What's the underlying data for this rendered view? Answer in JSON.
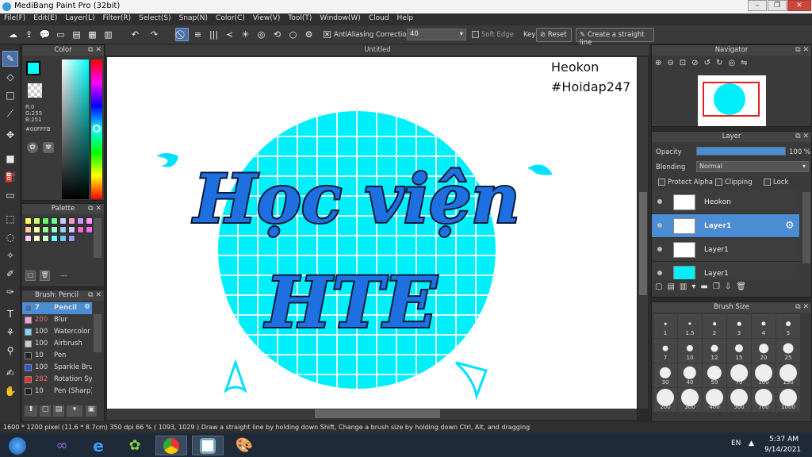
{
  "window": {
    "title": "MediBang Paint Pro (32bit)"
  },
  "menu": [
    "File(F)",
    "Edit(E)",
    "Layer(L)",
    "Filter(R)",
    "Select(S)",
    "Snap(N)",
    "Color(C)",
    "View(V)",
    "Tool(T)",
    "Window(W)",
    "Cloud",
    "Help"
  ],
  "toolbar": {
    "antialiasing_label": "AntiAliasing",
    "correction_label": "Correction",
    "correction_value": "40",
    "softedge_label": "Soft Edge",
    "key_label": "Key",
    "reset_label": "Reset",
    "straight_line_label": "Create a straight line"
  },
  "color_panel": {
    "title": "Color",
    "foreground": "#00FFFB",
    "r": "R:0",
    "g": "G:255",
    "b": "B:251",
    "hex": "#00FFFB"
  },
  "palette_panel": {
    "title": "Palette",
    "footer_text": "---",
    "colors": [
      "#ffff66",
      "#ccff66",
      "#66ff66",
      "#66ff99",
      "#ccccff",
      "#ff99cc",
      "#cc99ff",
      "#ff99ff",
      "#ffcc99",
      "#ffff99",
      "#99ff99",
      "#99ffcc",
      "#99ccff",
      "#ccccff",
      "#ff66cc",
      "#ff66ff",
      "#ffccff",
      "#ffffcc",
      "#ccffcc",
      "#66ffff",
      "#66ccff",
      "#9999ff"
    ]
  },
  "brush_panel": {
    "title": "Brush: Pencil",
    "items": [
      {
        "size": "7",
        "name": "Pencil",
        "color": "#3b6fd1",
        "selected": true
      },
      {
        "size": "200",
        "name": "Blur",
        "color": "#f2a2d8"
      },
      {
        "size": "100",
        "name": "Watercolor",
        "color": "#7fd4ff"
      },
      {
        "size": "100",
        "name": "Airbrush",
        "color": "#cccccc"
      },
      {
        "size": "10",
        "name": "Pen",
        "color": "#222222"
      },
      {
        "size": "100",
        "name": "Sparkle Brush",
        "color": "#3050e0"
      },
      {
        "size": "282",
        "name": "Rotation Symmetry",
        "color": "#e03030"
      },
      {
        "size": "10",
        "name": "Pen (Sharp)",
        "color": "#222222"
      }
    ]
  },
  "document": {
    "tab_title": "Untitled",
    "watermark_line1": "Heokon",
    "watermark_line2": "#Hoidap247",
    "art_line1": "Học viện",
    "art_line2": "HTE"
  },
  "navigator": {
    "title": "Navigator"
  },
  "layer_panel": {
    "title": "Layer",
    "opacity_label": "Opacity",
    "opacity_value": "100 %",
    "opacity_fraction": 1.0,
    "blending_label": "Blending",
    "blending_value": "Normal",
    "protect_alpha_label": "Protect Alpha",
    "clipping_label": "Clipping",
    "lock_label": "Lock",
    "layers": [
      {
        "name": "Heokon",
        "selected": false
      },
      {
        "name": "Layer1",
        "selected": true
      },
      {
        "name": "Layer1",
        "selected": false
      },
      {
        "name": "Layer1",
        "selected": false
      }
    ]
  },
  "brush_size_panel": {
    "title": "Brush Size",
    "sizes": [
      "1",
      "1.5",
      "2",
      "3",
      "4",
      "5",
      "7",
      "10",
      "12",
      "15",
      "20",
      "25",
      "30",
      "40",
      "50",
      "70",
      "100",
      "150",
      "200",
      "300",
      "400",
      "500",
      "700",
      "1000"
    ]
  },
  "status": {
    "text": "1600 * 1200 pixel   (11.6 * 8.7cm)   350 dpi   66 %   ( 1093, 1029 )   Draw a straight line by holding down Shift, Change a brush size by holding down Ctrl, Alt, and dragging"
  },
  "taskbar": {
    "lang": "EN",
    "time": "5:37 AM",
    "date": "9/14/2021"
  }
}
